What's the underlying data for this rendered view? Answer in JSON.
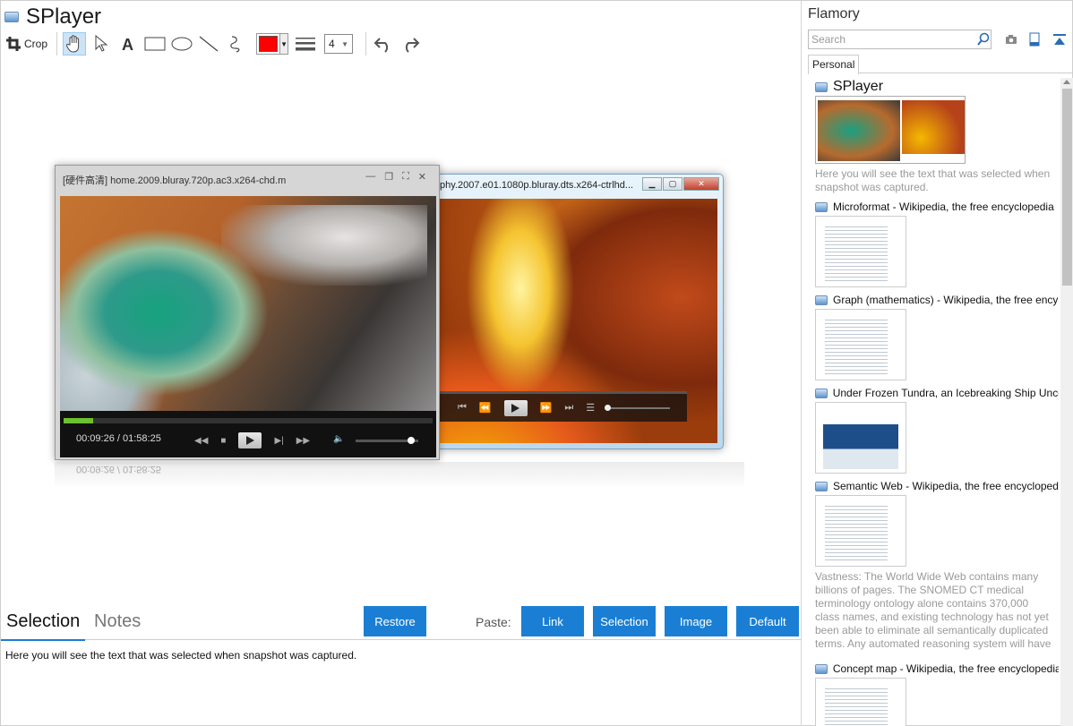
{
  "app": {
    "title": "SPlayer"
  },
  "toolbar": {
    "crop_label": "Crop",
    "line_width": "4",
    "pen_color": "#ff0000"
  },
  "screenshot": {
    "front_window_title": "[硬件高清] home.2009.bluray.720p.ac3.x264-chd.m",
    "back_window_title": "phy.2007.e01.1080p.bluray.dts.x264-ctrlhd...",
    "time_readout": "00:09:26 / 01:58:25",
    "reflection_text": "00:09:26 / 01:58:25"
  },
  "bottom": {
    "tab_selection": "Selection",
    "tab_notes": "Notes",
    "restore_label": "Restore",
    "paste_label": "Paste:",
    "paste_buttons": [
      "Link",
      "Selection",
      "Image",
      "Default"
    ],
    "notes_text": "Here you will see the text that was selected when snapshot was captured."
  },
  "flamory": {
    "title": "Flamory",
    "search_placeholder": "Search",
    "tab_personal": "Personal",
    "entries": [
      {
        "title": "SPlayer",
        "desc": "Here you will see the text that was selected when snapshot was captured."
      },
      {
        "title": "Microformat - Wikipedia, the free encyclopedia",
        "desc": ""
      },
      {
        "title": "Graph (mathematics) - Wikipedia, the free ency",
        "desc": ""
      },
      {
        "title": "Under Frozen Tundra, an Icebreaking Ship Unco",
        "desc": ""
      },
      {
        "title": "Semantic Web - Wikipedia, the free encycloped",
        "desc": "Vastness: The World Wide Web contains many billions of pages. The SNOMED CT medical terminology ontology alone contains 370,000 class names, and existing technology has not yet been able to eliminate all semantically duplicated terms. Any automated reasoning system will have to deal with truly huge inputs."
      },
      {
        "title": "Concept map - Wikipedia, the free encyclopedia",
        "desc": ""
      }
    ]
  }
}
